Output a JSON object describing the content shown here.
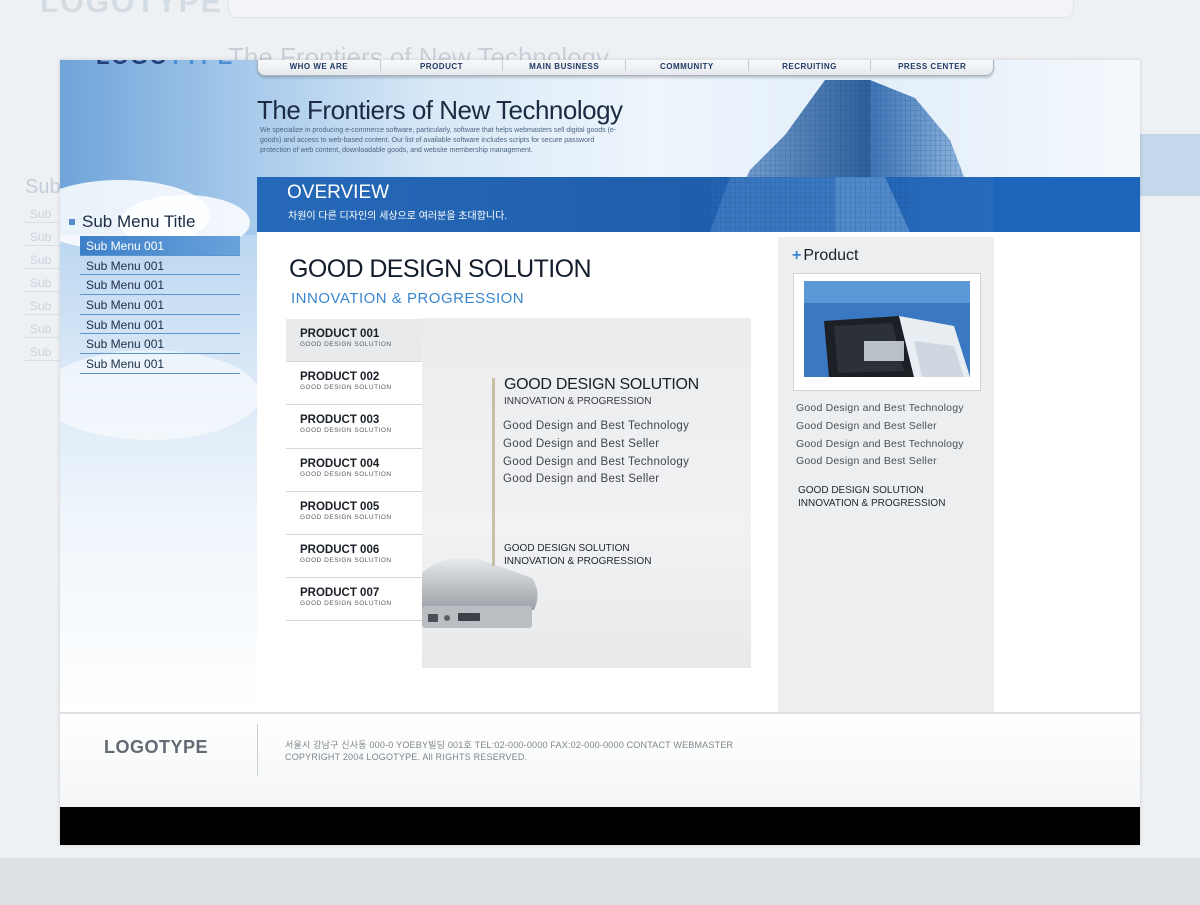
{
  "brand": {
    "logo_part1": "LOGO",
    "logo_part2": "TYPE",
    "footer_logo": "LOGOTYPE"
  },
  "nav": {
    "items": [
      "WHO WE ARE",
      "PRODUCT",
      "MAIN BUSINESS",
      "COMMUNITY",
      "RECRUITING",
      "PRESS CENTER"
    ]
  },
  "hero": {
    "title": "The Frontiers of New Technology",
    "description": "We specialize in producing e-commerce software, particularly, software that helps webmasters sell digital goods (e-goods) and access to web-based content. Our list of available software includes scripts for secure password protection of web content, downloadable goods, and website membership management."
  },
  "overview": {
    "title": "OVERVIEW",
    "subtitle": "차원이 다른 디자인의 세상으로 여러분을 초대합니다."
  },
  "submenu": {
    "title": "Sub Menu Title",
    "items": [
      "Sub Menu 001",
      "Sub Menu 001",
      "Sub Menu 001",
      "Sub Menu 001",
      "Sub Menu 001",
      "Sub Menu 001",
      "Sub Menu 001"
    ]
  },
  "main": {
    "headline": "GOOD DESIGN SOLUTION",
    "subheadline": "INNOVATION & PROGRESSION"
  },
  "products": [
    {
      "name": "PRODUCT 001",
      "desc": "GOOD DESIGN SOLUTION"
    },
    {
      "name": "PRODUCT 002",
      "desc": "GOOD DESIGN SOLUTION"
    },
    {
      "name": "PRODUCT 003",
      "desc": "GOOD DESIGN SOLUTION"
    },
    {
      "name": "PRODUCT 004",
      "desc": "GOOD DESIGN SOLUTION"
    },
    {
      "name": "PRODUCT 005",
      "desc": "GOOD DESIGN SOLUTION"
    },
    {
      "name": "PRODUCT 006",
      "desc": "GOOD DESIGN SOLUTION"
    },
    {
      "name": "PRODUCT 007",
      "desc": "GOOD DESIGN SOLUTION"
    }
  ],
  "feature": {
    "heading": "GOOD DESIGN SOLUTION",
    "subheading": "INNOVATION & PROGRESSION",
    "lines": [
      "Good Design and Best Technology",
      "Good Design and Best Seller",
      "Good Design and Best Technology",
      "Good Design and Best Seller"
    ],
    "foot_line1": "GOOD DESIGN SOLUTION",
    "foot_line2": "INNOVATION & PROGRESSION"
  },
  "sidebar_product": {
    "title": "Product",
    "lines": [
      "Good Design and Best Technology",
      "Good Design and Best Seller",
      "Good Design and Best Technology",
      "Good Design and Best Seller"
    ],
    "foot_line1": "GOOD DESIGN SOLUTION",
    "foot_line2": "INNOVATION & PROGRESSION"
  },
  "footer": {
    "address": "서울시 강남구 신사동 000-0 YOEBY빌딩 001호 TEL:02-000-0000 FAX:02-000-0000 CONTACT WEBMASTER",
    "copyright": "COPYRIGHT 2004 LOGOTYPE. All RIGHTS RESERVED."
  },
  "colors": {
    "accent": "#3a86cf",
    "band": "#1d5ca9",
    "submenu_active": "#3d7fc8"
  },
  "icons": [
    "plus-icon",
    "building-image",
    "laptop-image",
    "briefcase-image"
  ]
}
